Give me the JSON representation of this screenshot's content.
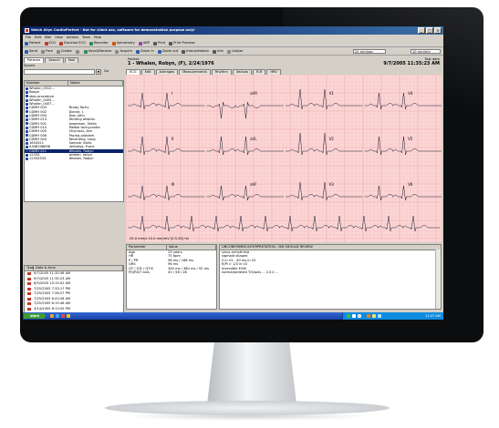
{
  "window": {
    "title": "Welch Allyn CardioPerfect - Not for client use, software for demonstration purpose only!",
    "controls": [
      "_",
      "□",
      "×"
    ]
  },
  "menu": [
    "File",
    "Edit",
    "Mail",
    "View",
    "Actions",
    "Tools",
    "Help"
  ],
  "toolbar1": {
    "buttons": [
      {
        "label": "Patient",
        "icon": "patient-icon",
        "color": "#2a5db0"
      },
      {
        "label": "ECG",
        "icon": "ecg-icon",
        "color": "#c0392b"
      },
      {
        "label": "Exercise ECG",
        "icon": "exercise-icon",
        "color": "#c0392b"
      },
      {
        "label": "Recorder",
        "icon": "recorder-icon",
        "color": "#2e8b57"
      },
      {
        "label": "Spirometry",
        "icon": "spirometry-icon",
        "color": "#d35400"
      },
      {
        "label": "ABP",
        "icon": "abp-icon",
        "color": "#8e44ad"
      },
      {
        "label": "Print",
        "icon": "print-icon",
        "color": "#555555"
      },
      {
        "label": "Print Preview",
        "icon": "print-preview-icon",
        "color": "#555555"
      }
    ]
  },
  "toolbar2": {
    "buttons": [
      {
        "label": "Send",
        "icon": "send-icon",
        "color": "#2a5db0"
      },
      {
        "label": "Fore",
        "icon": "forward-icon",
        "color": "#888888"
      },
      {
        "label": "Create",
        "icon": "create-icon",
        "color": "#888888"
      },
      {
        "label": "",
        "icon": "lock-icon",
        "color": "#888888"
      },
      {
        "label": "Save&Receive",
        "icon": "save-receive-icon",
        "color": "#2e8b57"
      },
      {
        "label": "Acquire",
        "icon": "acquire-icon",
        "color": "#888888"
      },
      {
        "label": "Zoom in",
        "icon": "zoom-in-icon",
        "color": "#2a5db0"
      },
      {
        "label": "Zoom out",
        "icon": "zoom-out-icon",
        "color": "#2a5db0"
      },
      {
        "label": "Interpretation",
        "icon": "interpretation-icon",
        "color": "#555555"
      },
      {
        "label": "Info",
        "icon": "info-icon",
        "color": "#555555"
      },
      {
        "label": "Caliper",
        "icon": "caliper-icon",
        "color": "#888888"
      }
    ],
    "speed": "25 mm/sec",
    "gain": "10 mm/mV"
  },
  "left": {
    "tabs": [
      "Patients",
      "Search",
      "Mail"
    ],
    "search_label": "Search",
    "go_label": "Go",
    "patient_columns": [
      "Number",
      "Name"
    ],
    "patients": [
      {
        "number": "Whalen_0312...",
        "name": ""
      },
      {
        "number": "Robyn",
        "name": ""
      },
      {
        "number": "step procedure",
        "name": ""
      },
      {
        "number": "Whalen_0405...",
        "name": ""
      },
      {
        "number": "Whalen_0407...",
        "name": ""
      },
      {
        "number": "CDMH 003",
        "name": "Brady,Tachy"
      },
      {
        "number": "CDMH 002",
        "name": "Donne, J."
      },
      {
        "number": "CDMH 000",
        "name": "Doe, John"
      },
      {
        "number": "CDMH 013",
        "name": "Fainting attacks"
      },
      {
        "number": "CDMH 001",
        "name": "Jorgensen, Stella"
      },
      {
        "number": "CDMH 010",
        "name": "Medial tachycardia"
      },
      {
        "number": "CDMH 005",
        "name": "Shymous, Ann"
      },
      {
        "number": "CDMH 006",
        "name": "Pacing problem"
      },
      {
        "number": "CDMH 004",
        "name": "Recording, Long"
      },
      {
        "number": "1654321",
        "name": "Sample, Karla"
      },
      {
        "number": "A348208698",
        "name": "Verbetsa, Frank"
      },
      {
        "number": "CDMH 011",
        "name": "Whalen, Robyn"
      },
      {
        "number": "12333",
        "name": "whalen, robyn"
      },
      {
        "number": "12333333",
        "name": "Whalen, Robyn"
      }
    ],
    "selected_index": 16,
    "test_columns": [
      "Type",
      "Date & time"
    ],
    "tests": [
      "9/7/2005 11:35:56 AM",
      "9/7/2005 11:35:23 AM",
      "8/5/2005 10:15:41 AM",
      "7/25/2005 7:33:17 PM",
      "7/25/2005 7:28:27 PM",
      "7/25/2005 6:43:28 AM",
      "7/25/2005 6:15:46 AM",
      "3/14/2005 8:13:55 PM"
    ]
  },
  "right": {
    "patient_label": "Patient",
    "patient_name": "1 - Whalen, Robyn, (F), 2/24/1976",
    "test_date_label": "Test date",
    "test_date": "9/7/2005 11:35:23 AM",
    "tabs": [
      "ECG",
      "Edit",
      "Averages",
      "Measurements",
      "Rhythm",
      "Vectors",
      "R-R",
      "HRV"
    ],
    "ecg_footer": "25.0 mm/s 10.0 mm/mV [0.5-35] Hz",
    "meas_columns": [
      "Parameter",
      "Value"
    ],
    "measurements": [
      {
        "param": "Age",
        "value": "29 years"
      },
      {
        "param": "HR",
        "value": "75 bpm"
      },
      {
        "param": "P / PR",
        "value": "98 ms / 168 ms"
      },
      {
        "param": "QRS",
        "value": "96 ms"
      },
      {
        "param": "QT / QTc / QT-6",
        "value": "340 ms / 380 ms / 92 ms"
      },
      {
        "param": "P/QRS/T axis",
        "value": "45 / 58 / 28"
      }
    ],
    "interp_header": "UNCONFIRMED INTERPRETATION - MD SHOULD REVIEW",
    "interp_lines": [
      "sinus arrhythmia",
      "sigmoid shaped",
      "S in V1 - 40 ms in V2",
      "R/Pi > 1/3 in V2",
      "inversible EVW",
      "normal/ordered T/S/axis ... 2.0:1 ..."
    ]
  },
  "ecg": {
    "leads": [
      [
        "I",
        "aVR",
        "V1",
        "V4"
      ],
      [
        "II",
        "aVL",
        "V2",
        "V5"
      ],
      [
        "III",
        "aVF",
        "V3",
        "V6"
      ]
    ],
    "grid_color": "#f4a6a9",
    "paper_color": "#fbd7d6",
    "trace_color": "#1a1a33"
  },
  "taskbar": {
    "start_label": "start",
    "clock": "11:47 AM"
  }
}
